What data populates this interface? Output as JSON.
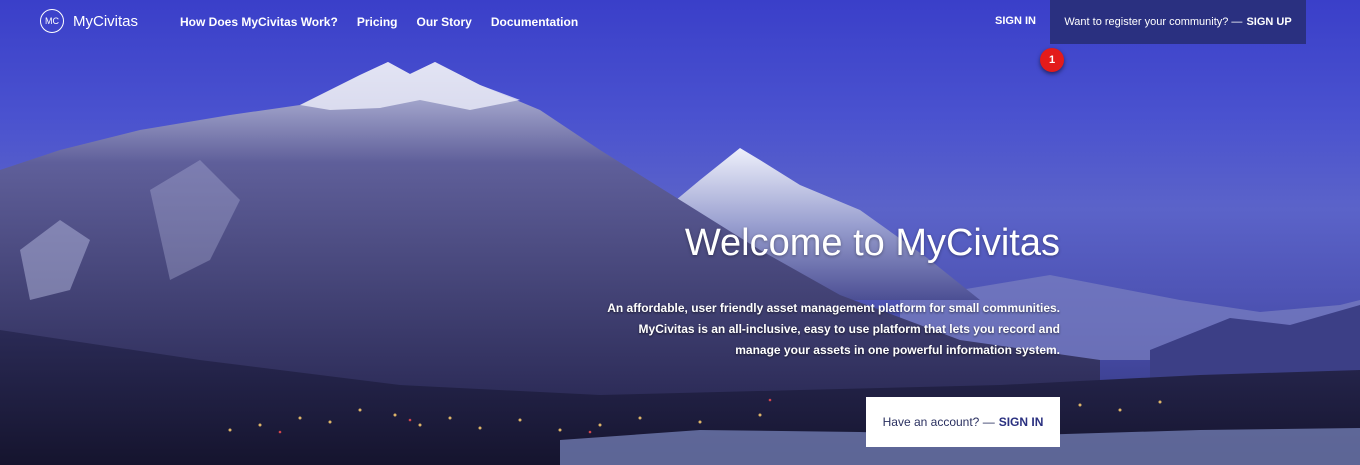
{
  "brand": {
    "mark": "MC",
    "name": "MyCivitas"
  },
  "nav": {
    "items": [
      {
        "label": "How Does MyCivitas Work?"
      },
      {
        "label": "Pricing"
      },
      {
        "label": "Our Story"
      },
      {
        "label": "Documentation"
      }
    ],
    "signin_label": "SIGN IN"
  },
  "register": {
    "prompt": "Want to register your community? —",
    "action": "SIGN UP"
  },
  "badge": {
    "number": "1"
  },
  "hero": {
    "title": "Welcome to MyCivitas",
    "description_lines": [
      "An affordable, user friendly asset management platform for small communities.",
      "MyCivitas is an all-inclusive, easy to use platform that lets you record and",
      "manage your assets in one powerful information system."
    ]
  },
  "account": {
    "prompt": "Have an account? —",
    "action": "SIGN IN"
  },
  "colors": {
    "register_bg": "#2a3080",
    "badge": "#e31b1b",
    "account_bg": "#ffffff"
  }
}
